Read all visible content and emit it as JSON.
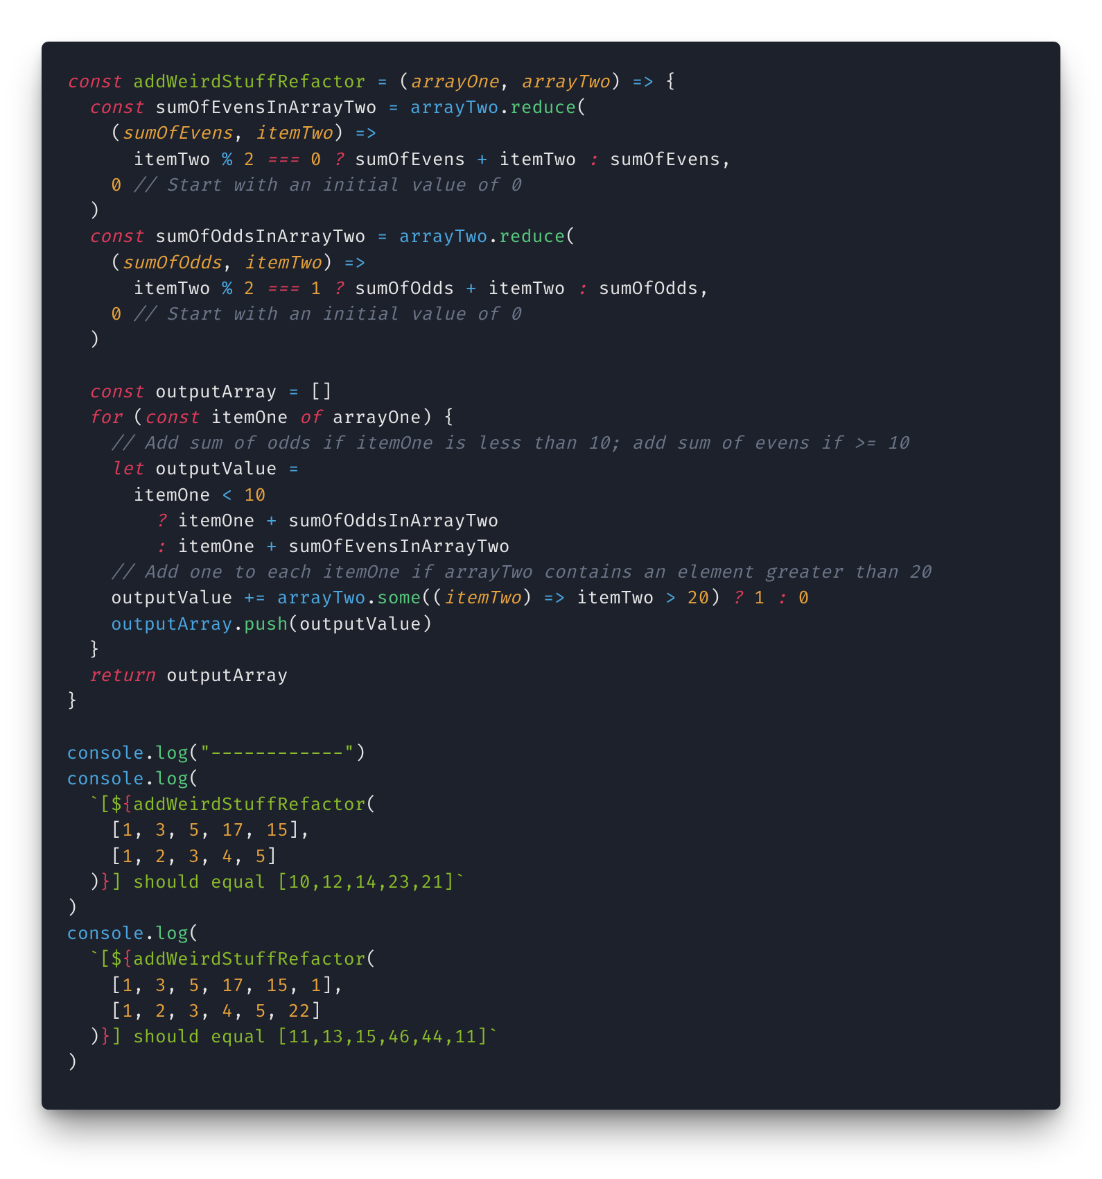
{
  "theme": {
    "background": "#1d212b",
    "foreground": "#e6e6e6",
    "keyword": "#e03b5a",
    "function_decl": "#8abb2a",
    "function_call": "#57c97d",
    "parameter": "#e7a23c",
    "number": "#e7a23c",
    "string": "#8abb2a",
    "comment": "#6b7588",
    "operator": "#4aa6e0",
    "object": "#4aa6e0"
  },
  "code": {
    "language": "javascript",
    "lines": [
      [
        {
          "cls": "kw",
          "t": "const"
        },
        {
          "cls": "punct",
          "t": " "
        },
        {
          "cls": "fn-decl",
          "t": "addWeirdStuffRefactor"
        },
        {
          "cls": "punct",
          "t": " "
        },
        {
          "cls": "op",
          "t": "="
        },
        {
          "cls": "punct",
          "t": " ("
        },
        {
          "cls": "param",
          "t": "arrayOne"
        },
        {
          "cls": "punct",
          "t": ", "
        },
        {
          "cls": "param",
          "t": "arrayTwo"
        },
        {
          "cls": "punct",
          "t": ") "
        },
        {
          "cls": "op",
          "t": "=>"
        },
        {
          "cls": "punct",
          "t": " {"
        }
      ],
      [
        {
          "cls": "punct",
          "t": "  "
        },
        {
          "cls": "kw",
          "t": "const"
        },
        {
          "cls": "punct",
          "t": " "
        },
        {
          "cls": "ident",
          "t": "sumOfEvensInArrayTwo"
        },
        {
          "cls": "punct",
          "t": " "
        },
        {
          "cls": "op",
          "t": "="
        },
        {
          "cls": "punct",
          "t": " "
        },
        {
          "cls": "obj",
          "t": "arrayTwo"
        },
        {
          "cls": "punct",
          "t": "."
        },
        {
          "cls": "fn-call",
          "t": "reduce"
        },
        {
          "cls": "punct",
          "t": "("
        }
      ],
      [
        {
          "cls": "punct",
          "t": "    ("
        },
        {
          "cls": "param",
          "t": "sumOfEvens"
        },
        {
          "cls": "punct",
          "t": ", "
        },
        {
          "cls": "param",
          "t": "itemTwo"
        },
        {
          "cls": "punct",
          "t": ") "
        },
        {
          "cls": "op",
          "t": "=>"
        }
      ],
      [
        {
          "cls": "punct",
          "t": "      "
        },
        {
          "cls": "ident",
          "t": "itemTwo"
        },
        {
          "cls": "punct",
          "t": " "
        },
        {
          "cls": "op",
          "t": "%"
        },
        {
          "cls": "punct",
          "t": " "
        },
        {
          "cls": "num",
          "t": "2"
        },
        {
          "cls": "punct",
          "t": " "
        },
        {
          "cls": "eqeq",
          "t": "==="
        },
        {
          "cls": "punct",
          "t": " "
        },
        {
          "cls": "num",
          "t": "0"
        },
        {
          "cls": "punct",
          "t": " "
        },
        {
          "cls": "tern",
          "t": "?"
        },
        {
          "cls": "punct",
          "t": " "
        },
        {
          "cls": "ident",
          "t": "sumOfEvens"
        },
        {
          "cls": "punct",
          "t": " "
        },
        {
          "cls": "op",
          "t": "+"
        },
        {
          "cls": "punct",
          "t": " "
        },
        {
          "cls": "ident",
          "t": "itemTwo"
        },
        {
          "cls": "punct",
          "t": " "
        },
        {
          "cls": "tern",
          "t": ":"
        },
        {
          "cls": "punct",
          "t": " "
        },
        {
          "cls": "ident",
          "t": "sumOfEvens"
        },
        {
          "cls": "punct",
          "t": ","
        }
      ],
      [
        {
          "cls": "punct",
          "t": "    "
        },
        {
          "cls": "num",
          "t": "0"
        },
        {
          "cls": "punct",
          "t": " "
        },
        {
          "cls": "cmt",
          "t": "// Start with an initial value of 0"
        }
      ],
      [
        {
          "cls": "punct",
          "t": "  )"
        }
      ],
      [
        {
          "cls": "punct",
          "t": "  "
        },
        {
          "cls": "kw",
          "t": "const"
        },
        {
          "cls": "punct",
          "t": " "
        },
        {
          "cls": "ident",
          "t": "sumOfOddsInArrayTwo"
        },
        {
          "cls": "punct",
          "t": " "
        },
        {
          "cls": "op",
          "t": "="
        },
        {
          "cls": "punct",
          "t": " "
        },
        {
          "cls": "obj",
          "t": "arrayTwo"
        },
        {
          "cls": "punct",
          "t": "."
        },
        {
          "cls": "fn-call",
          "t": "reduce"
        },
        {
          "cls": "punct",
          "t": "("
        }
      ],
      [
        {
          "cls": "punct",
          "t": "    ("
        },
        {
          "cls": "param",
          "t": "sumOfOdds"
        },
        {
          "cls": "punct",
          "t": ", "
        },
        {
          "cls": "param",
          "t": "itemTwo"
        },
        {
          "cls": "punct",
          "t": ") "
        },
        {
          "cls": "op",
          "t": "=>"
        }
      ],
      [
        {
          "cls": "punct",
          "t": "      "
        },
        {
          "cls": "ident",
          "t": "itemTwo"
        },
        {
          "cls": "punct",
          "t": " "
        },
        {
          "cls": "op",
          "t": "%"
        },
        {
          "cls": "punct",
          "t": " "
        },
        {
          "cls": "num",
          "t": "2"
        },
        {
          "cls": "punct",
          "t": " "
        },
        {
          "cls": "eqeq",
          "t": "==="
        },
        {
          "cls": "punct",
          "t": " "
        },
        {
          "cls": "num",
          "t": "1"
        },
        {
          "cls": "punct",
          "t": " "
        },
        {
          "cls": "tern",
          "t": "?"
        },
        {
          "cls": "punct",
          "t": " "
        },
        {
          "cls": "ident",
          "t": "sumOfOdds"
        },
        {
          "cls": "punct",
          "t": " "
        },
        {
          "cls": "op",
          "t": "+"
        },
        {
          "cls": "punct",
          "t": " "
        },
        {
          "cls": "ident",
          "t": "itemTwo"
        },
        {
          "cls": "punct",
          "t": " "
        },
        {
          "cls": "tern",
          "t": ":"
        },
        {
          "cls": "punct",
          "t": " "
        },
        {
          "cls": "ident",
          "t": "sumOfOdds"
        },
        {
          "cls": "punct",
          "t": ","
        }
      ],
      [
        {
          "cls": "punct",
          "t": "    "
        },
        {
          "cls": "num",
          "t": "0"
        },
        {
          "cls": "punct",
          "t": " "
        },
        {
          "cls": "cmt",
          "t": "// Start with an initial value of 0"
        }
      ],
      [
        {
          "cls": "punct",
          "t": "  )"
        }
      ],
      [
        {
          "cls": "punct",
          "t": ""
        }
      ],
      [
        {
          "cls": "punct",
          "t": "  "
        },
        {
          "cls": "kw",
          "t": "const"
        },
        {
          "cls": "punct",
          "t": " "
        },
        {
          "cls": "ident",
          "t": "outputArray"
        },
        {
          "cls": "punct",
          "t": " "
        },
        {
          "cls": "op",
          "t": "="
        },
        {
          "cls": "punct",
          "t": " []"
        }
      ],
      [
        {
          "cls": "punct",
          "t": "  "
        },
        {
          "cls": "kw",
          "t": "for"
        },
        {
          "cls": "punct",
          "t": " ("
        },
        {
          "cls": "kw",
          "t": "const"
        },
        {
          "cls": "punct",
          "t": " "
        },
        {
          "cls": "ident",
          "t": "itemOne"
        },
        {
          "cls": "punct",
          "t": " "
        },
        {
          "cls": "kw",
          "t": "of"
        },
        {
          "cls": "punct",
          "t": " "
        },
        {
          "cls": "ident",
          "t": "arrayOne"
        },
        {
          "cls": "punct",
          "t": ") {"
        }
      ],
      [
        {
          "cls": "punct",
          "t": "    "
        },
        {
          "cls": "cmt",
          "t": "// Add sum of odds if itemOne is less than 10; add sum of evens if >= 10"
        }
      ],
      [
        {
          "cls": "punct",
          "t": "    "
        },
        {
          "cls": "kw",
          "t": "let"
        },
        {
          "cls": "punct",
          "t": " "
        },
        {
          "cls": "ident",
          "t": "outputValue"
        },
        {
          "cls": "punct",
          "t": " "
        },
        {
          "cls": "op",
          "t": "="
        }
      ],
      [
        {
          "cls": "punct",
          "t": "      "
        },
        {
          "cls": "ident",
          "t": "itemOne"
        },
        {
          "cls": "punct",
          "t": " "
        },
        {
          "cls": "op",
          "t": "<"
        },
        {
          "cls": "punct",
          "t": " "
        },
        {
          "cls": "num",
          "t": "10"
        }
      ],
      [
        {
          "cls": "punct",
          "t": "        "
        },
        {
          "cls": "tern",
          "t": "?"
        },
        {
          "cls": "punct",
          "t": " "
        },
        {
          "cls": "ident",
          "t": "itemOne"
        },
        {
          "cls": "punct",
          "t": " "
        },
        {
          "cls": "op",
          "t": "+"
        },
        {
          "cls": "punct",
          "t": " "
        },
        {
          "cls": "ident",
          "t": "sumOfOddsInArrayTwo"
        }
      ],
      [
        {
          "cls": "punct",
          "t": "        "
        },
        {
          "cls": "tern",
          "t": ":"
        },
        {
          "cls": "punct",
          "t": " "
        },
        {
          "cls": "ident",
          "t": "itemOne"
        },
        {
          "cls": "punct",
          "t": " "
        },
        {
          "cls": "op",
          "t": "+"
        },
        {
          "cls": "punct",
          "t": " "
        },
        {
          "cls": "ident",
          "t": "sumOfEvensInArrayTwo"
        }
      ],
      [
        {
          "cls": "punct",
          "t": "    "
        },
        {
          "cls": "cmt",
          "t": "// Add one to each itemOne if arrayTwo contains an element greater than 20"
        }
      ],
      [
        {
          "cls": "punct",
          "t": "    "
        },
        {
          "cls": "ident",
          "t": "outputValue"
        },
        {
          "cls": "punct",
          "t": " "
        },
        {
          "cls": "op",
          "t": "+="
        },
        {
          "cls": "punct",
          "t": " "
        },
        {
          "cls": "obj",
          "t": "arrayTwo"
        },
        {
          "cls": "punct",
          "t": "."
        },
        {
          "cls": "fn-call",
          "t": "some"
        },
        {
          "cls": "punct",
          "t": "(("
        },
        {
          "cls": "param",
          "t": "itemTwo"
        },
        {
          "cls": "punct",
          "t": ") "
        },
        {
          "cls": "op",
          "t": "=>"
        },
        {
          "cls": "punct",
          "t": " "
        },
        {
          "cls": "ident",
          "t": "itemTwo"
        },
        {
          "cls": "punct",
          "t": " "
        },
        {
          "cls": "op",
          "t": ">"
        },
        {
          "cls": "punct",
          "t": " "
        },
        {
          "cls": "num",
          "t": "20"
        },
        {
          "cls": "punct",
          "t": ") "
        },
        {
          "cls": "tern",
          "t": "?"
        },
        {
          "cls": "punct",
          "t": " "
        },
        {
          "cls": "num",
          "t": "1"
        },
        {
          "cls": "punct",
          "t": " "
        },
        {
          "cls": "tern",
          "t": ":"
        },
        {
          "cls": "punct",
          "t": " "
        },
        {
          "cls": "num",
          "t": "0"
        }
      ],
      [
        {
          "cls": "punct",
          "t": "    "
        },
        {
          "cls": "obj",
          "t": "outputArray"
        },
        {
          "cls": "punct",
          "t": "."
        },
        {
          "cls": "fn-call",
          "t": "push"
        },
        {
          "cls": "punct",
          "t": "("
        },
        {
          "cls": "ident",
          "t": "outputValue"
        },
        {
          "cls": "punct",
          "t": ")"
        }
      ],
      [
        {
          "cls": "punct",
          "t": "  }"
        }
      ],
      [
        {
          "cls": "punct",
          "t": "  "
        },
        {
          "cls": "kw",
          "t": "return"
        },
        {
          "cls": "punct",
          "t": " "
        },
        {
          "cls": "ident",
          "t": "outputArray"
        }
      ],
      [
        {
          "cls": "punct",
          "t": "}"
        }
      ],
      [
        {
          "cls": "punct",
          "t": ""
        }
      ],
      [
        {
          "cls": "obj",
          "t": "console"
        },
        {
          "cls": "punct",
          "t": "."
        },
        {
          "cls": "fn-call",
          "t": "log"
        },
        {
          "cls": "punct",
          "t": "("
        },
        {
          "cls": "str",
          "t": "\"------------\""
        },
        {
          "cls": "punct",
          "t": ")"
        }
      ],
      [
        {
          "cls": "obj",
          "t": "console"
        },
        {
          "cls": "punct",
          "t": "."
        },
        {
          "cls": "fn-call",
          "t": "log"
        },
        {
          "cls": "punct",
          "t": "("
        }
      ],
      [
        {
          "cls": "punct",
          "t": "  "
        },
        {
          "cls": "str",
          "t": "`[$"
        },
        {
          "cls": "tmpl-d",
          "t": "{"
        },
        {
          "cls": "fn-decl",
          "t": "addWeirdStuffRefactor"
        },
        {
          "cls": "punct",
          "t": "("
        }
      ],
      [
        {
          "cls": "punct",
          "t": "    ["
        },
        {
          "cls": "num",
          "t": "1"
        },
        {
          "cls": "punct",
          "t": ", "
        },
        {
          "cls": "num",
          "t": "3"
        },
        {
          "cls": "punct",
          "t": ", "
        },
        {
          "cls": "num",
          "t": "5"
        },
        {
          "cls": "punct",
          "t": ", "
        },
        {
          "cls": "num",
          "t": "17"
        },
        {
          "cls": "punct",
          "t": ", "
        },
        {
          "cls": "num",
          "t": "15"
        },
        {
          "cls": "punct",
          "t": "],"
        }
      ],
      [
        {
          "cls": "punct",
          "t": "    ["
        },
        {
          "cls": "num",
          "t": "1"
        },
        {
          "cls": "punct",
          "t": ", "
        },
        {
          "cls": "num",
          "t": "2"
        },
        {
          "cls": "punct",
          "t": ", "
        },
        {
          "cls": "num",
          "t": "3"
        },
        {
          "cls": "punct",
          "t": ", "
        },
        {
          "cls": "num",
          "t": "4"
        },
        {
          "cls": "punct",
          "t": ", "
        },
        {
          "cls": "num",
          "t": "5"
        },
        {
          "cls": "punct",
          "t": "]"
        }
      ],
      [
        {
          "cls": "punct",
          "t": "  )"
        },
        {
          "cls": "tmpl-d",
          "t": "}"
        },
        {
          "cls": "str",
          "t": "] should equal [10,12,14,23,21]`"
        }
      ],
      [
        {
          "cls": "punct",
          "t": ")"
        }
      ],
      [
        {
          "cls": "obj",
          "t": "console"
        },
        {
          "cls": "punct",
          "t": "."
        },
        {
          "cls": "fn-call",
          "t": "log"
        },
        {
          "cls": "punct",
          "t": "("
        }
      ],
      [
        {
          "cls": "punct",
          "t": "  "
        },
        {
          "cls": "str",
          "t": "`[$"
        },
        {
          "cls": "tmpl-d",
          "t": "{"
        },
        {
          "cls": "fn-decl",
          "t": "addWeirdStuffRefactor"
        },
        {
          "cls": "punct",
          "t": "("
        }
      ],
      [
        {
          "cls": "punct",
          "t": "    ["
        },
        {
          "cls": "num",
          "t": "1"
        },
        {
          "cls": "punct",
          "t": ", "
        },
        {
          "cls": "num",
          "t": "3"
        },
        {
          "cls": "punct",
          "t": ", "
        },
        {
          "cls": "num",
          "t": "5"
        },
        {
          "cls": "punct",
          "t": ", "
        },
        {
          "cls": "num",
          "t": "17"
        },
        {
          "cls": "punct",
          "t": ", "
        },
        {
          "cls": "num",
          "t": "15"
        },
        {
          "cls": "punct",
          "t": ", "
        },
        {
          "cls": "num",
          "t": "1"
        },
        {
          "cls": "punct",
          "t": "],"
        }
      ],
      [
        {
          "cls": "punct",
          "t": "    ["
        },
        {
          "cls": "num",
          "t": "1"
        },
        {
          "cls": "punct",
          "t": ", "
        },
        {
          "cls": "num",
          "t": "2"
        },
        {
          "cls": "punct",
          "t": ", "
        },
        {
          "cls": "num",
          "t": "3"
        },
        {
          "cls": "punct",
          "t": ", "
        },
        {
          "cls": "num",
          "t": "4"
        },
        {
          "cls": "punct",
          "t": ", "
        },
        {
          "cls": "num",
          "t": "5"
        },
        {
          "cls": "punct",
          "t": ", "
        },
        {
          "cls": "num",
          "t": "22"
        },
        {
          "cls": "punct",
          "t": "]"
        }
      ],
      [
        {
          "cls": "punct",
          "t": "  )"
        },
        {
          "cls": "tmpl-d",
          "t": "}"
        },
        {
          "cls": "str",
          "t": "] should equal [11,13,15,46,44,11]`"
        }
      ],
      [
        {
          "cls": "punct",
          "t": ")"
        }
      ]
    ]
  }
}
